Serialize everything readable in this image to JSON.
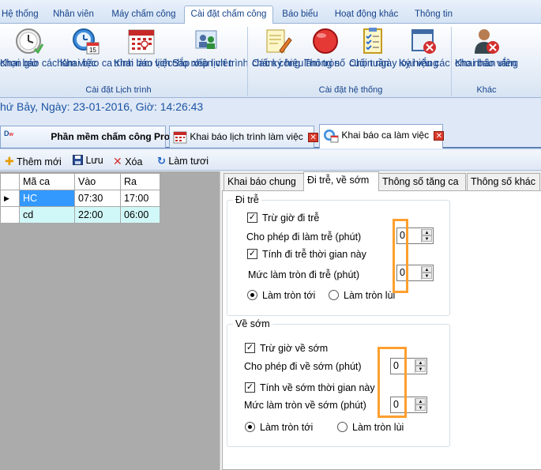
{
  "menu": {
    "tabs": [
      "Hệ thống",
      "Nhân viên",
      "Máy chấm công",
      "Cài đặt chấm công",
      "Báo biểu",
      "Hoạt động khác",
      "Thông tin"
    ],
    "active_tab": "Cài đặt chấm công"
  },
  "ribbon": {
    "groups": [
      {
        "label": "Cài đặt Lịch trình"
      },
      {
        "label": "Cài đặt hệ thống"
      },
      {
        "label": "Khác"
      }
    ],
    "buttons": [
      {
        "l1": "Khai báo cách",
        "l2": "chọn giờ",
        "icon": "clock-icon"
      },
      {
        "l1": "Khai báo ca",
        "l2": "làm việc",
        "icon": "calendar-clock-icon"
      },
      {
        "l1": "Khai báo lịch",
        "l2": "trình làm việc",
        "icon": "calendar-icon"
      },
      {
        "l1": "Sắp xếp lịch trình",
        "l2": "cho nhân viên",
        "icon": "users-schedule-icon"
      },
      {
        "l1": "Các ký hiệu",
        "l2": "chấm công",
        "icon": "note-pen-icon"
      },
      {
        "l1": "Thông số",
        "l2": "làm tròn",
        "icon": "red-circle-icon"
      },
      {
        "l1": "Chọn ngày",
        "l2": "cuối tuần",
        "icon": "checklist-icon"
      },
      {
        "l1": "Ký hiệu các",
        "l2": "loại vắng",
        "icon": "absence-icon"
      },
      {
        "l1": "Khai báo vắng",
        "l2": "cho nhân viên",
        "icon": "user-remove-icon"
      }
    ]
  },
  "datebar": {
    "text": "hứ Bảy, Ngày: 23-01-2016, Giờ: 14:26:43"
  },
  "doc_tabs": [
    {
      "label": "Phần mềm chấm công Pro",
      "icon": "app-logo-icon",
      "closable": false
    },
    {
      "label": "Khai báo lịch trình làm việc",
      "icon": "calendar-icon",
      "closable": true
    },
    {
      "label": "Khai báo ca làm việc",
      "icon": "calendar-clock-icon",
      "closable": true
    }
  ],
  "toolbar": {
    "add_label": "Thêm mới",
    "save_label": "Lưu",
    "delete_label": "Xóa",
    "refresh_label": "Làm tươi"
  },
  "grid": {
    "headers": [
      "Mã ca",
      "Vào",
      "Ra"
    ],
    "rows": [
      {
        "code": "HC",
        "in": "07:30",
        "out": "17:00"
      },
      {
        "code": "cd",
        "in": "22:00",
        "out": "06:00"
      }
    ]
  },
  "subtabs": [
    "Khai báo chung",
    "Đi trễ, về sớm",
    "Thông số tăng ca",
    "Thông số khác"
  ],
  "late": {
    "caption": "Đi trễ",
    "deduct_label": "Trừ giờ đi trễ",
    "allow_label": "Cho phép đi làm trễ (phút)",
    "allow_value": "0",
    "count_label": "Tính đi trễ thời gian này",
    "round_label": "Mức làm tròn đi trễ (phút)",
    "round_value": "0",
    "round_up_label": "Làm tròn tới",
    "round_down_label": "Làm tròn lùi"
  },
  "early": {
    "caption": "Về sớm",
    "deduct_label": "Trừ giờ về sớm",
    "allow_label": "Cho phép đi về sớm (phút)",
    "allow_value": "0",
    "count_label": "Tính về sớm thời gian này",
    "round_label": "Mức làm tròn về sớm (phút)",
    "round_value": "0",
    "round_up_label": "Làm tròn tới",
    "round_down_label": "Làm tròn lùi"
  },
  "colors": {
    "accent": "#15428b",
    "highlight": "#ff9f2e",
    "selected_cell": "#3399ff",
    "alt_row": "#d1f8f8"
  }
}
